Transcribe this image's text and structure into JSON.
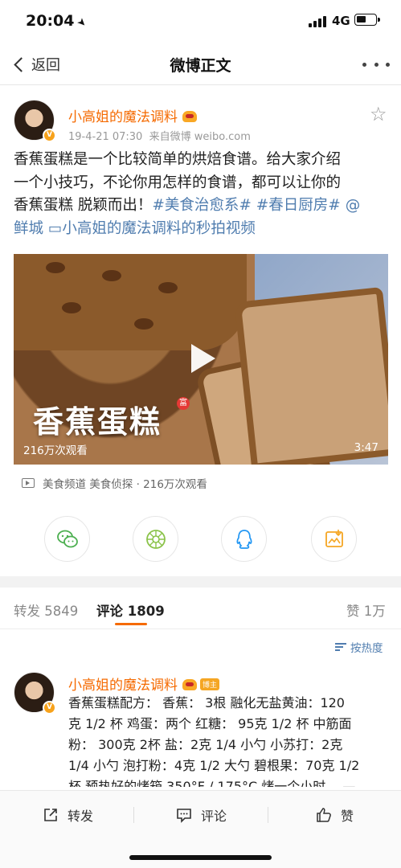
{
  "status_bar": {
    "time": "20:04",
    "network": "4G"
  },
  "nav": {
    "back_label": "返回",
    "title": "微博正文"
  },
  "post": {
    "author": "小高姐的魔法调料",
    "time": "19-4-21 07:30",
    "source": "来自微博 weibo.com",
    "text_lines": [
      {
        "plain": "香蕉蛋糕是一个比较简单的烘焙食谱。给大家介绍"
      },
      {
        "plain": "一个小技巧，不论你用怎样的食谱，都可以让你的"
      },
      {
        "plain": "香蕉蛋糕 脱颖而出！",
        "link1": "#美食治愈系#",
        "link2": "#春日厨房#",
        "link3": "@"
      },
      {
        "link1": "鲜城",
        "link2": "小高姐的魔法调料的秒拍视频"
      }
    ],
    "video": {
      "caption": "香蕉蛋糕",
      "caption_badge": "富",
      "views": "216万次观看",
      "duration": "3:47"
    },
    "source_line": "美食频道 美食侦探 · 216万次观看",
    "share_icons": [
      "wechat-icon",
      "moments-icon",
      "qq-icon",
      "save-image-icon"
    ]
  },
  "tabs": {
    "repost_label": "转发",
    "repost_count": "5849",
    "comment_label": "评论",
    "comment_count": "1809",
    "like_label": "赞",
    "like_count": "1万"
  },
  "sort_label": "按热度",
  "comment": {
    "author": "小高姐的魔法调料",
    "badge": "博主",
    "lines": [
      "香蕉蛋糕配方： 香蕉： 3根 融化无盐黄油：120",
      "克 1/2 杯 鸡蛋：两个 红糖： 95克 1/2 杯 中筋面",
      "粉： 300克 2杯 盐：2克 1/4 小勺 小苏打：2克",
      "1/4 小勺 泡打粉：4克 1/2 大勺 碧根果：70克 1/2",
      "杯 预热好的烤箱 350°F / 175°C 烤一个小时。 —"
    ]
  },
  "toolbar": {
    "repost": "转发",
    "comment": "评论",
    "like": "赞"
  },
  "colors": {
    "accent": "#f56a00",
    "link": "#507daf",
    "muted": "#999999"
  }
}
